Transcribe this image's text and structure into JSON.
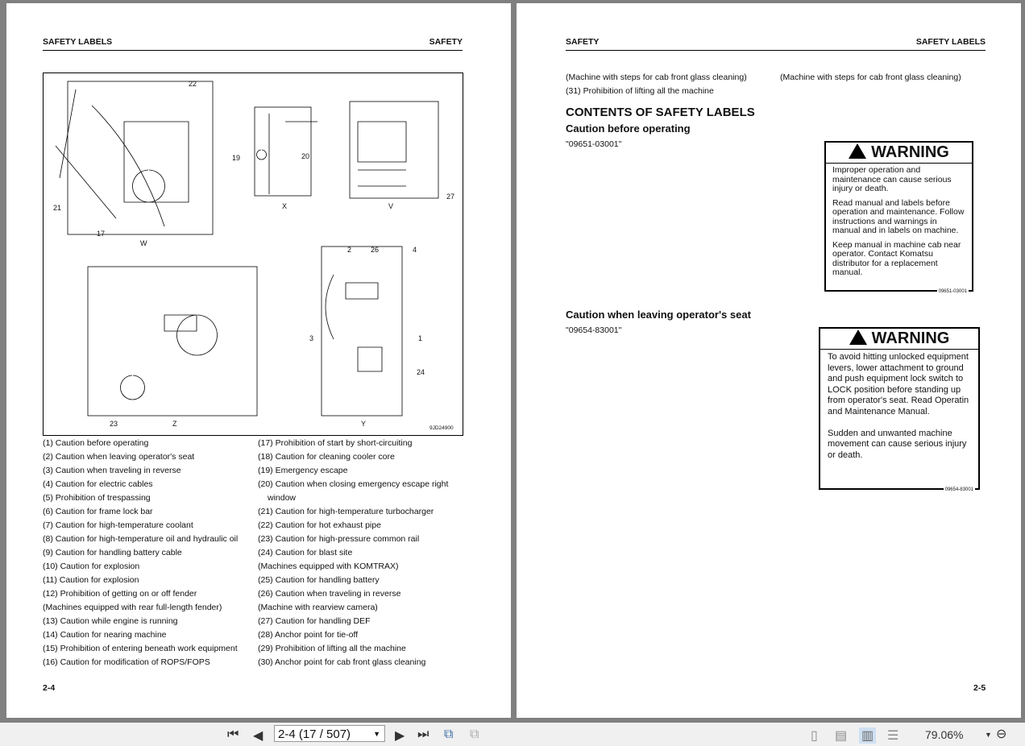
{
  "left_page": {
    "header_left": "SAFETY LABELS",
    "header_right": "SAFETY",
    "figure": {
      "code": "9JD24900",
      "views": [
        "W",
        "X",
        "V",
        "Z",
        "Y"
      ],
      "callouts": [
        "22",
        "21",
        "17",
        "19",
        "20",
        "27",
        "2",
        "26",
        "4",
        "3",
        "1",
        "24",
        "23"
      ]
    },
    "col1": [
      "(1) Caution before operating",
      "(2) Caution when leaving operator's seat",
      "(3) Caution when traveling in reverse",
      "(4) Caution for electric cables",
      "(5) Prohibition of trespassing",
      "(6) Caution for frame lock bar",
      "(7) Caution for high-temperature coolant",
      "(8) Caution for high-temperature oil and hydraulic oil",
      "(9) Caution for handling battery cable",
      "(10) Caution for explosion",
      "(11) Caution for explosion",
      "(12) Prohibition of getting on or off fender",
      "(Machines equipped with rear full-length fender)",
      "(13) Caution while engine is running",
      "(14) Caution for nearing machine",
      "(15) Prohibition of entering beneath work equipment",
      "(16) Caution for modification of ROPS/FOPS"
    ],
    "col2": [
      "(17) Prohibition of start by short-circuiting",
      "(18) Caution for cleaning cooler core",
      "(19) Emergency escape",
      "(20) Caution when closing emergency escape right",
      "window",
      "(21) Caution for high-temperature turbocharger",
      "(22) Caution for hot exhaust pipe",
      "(23) Caution for high-pressure common rail",
      "(24) Caution for blast site",
      "(Machines equipped with KOMTRAX)",
      "(25) Caution for handling battery",
      "(26) Caution when traveling in reverse",
      "(Machine with rearview camera)",
      "(27) Caution for handling DEF",
      "(28) Anchor point for tie-off",
      "(29) Prohibition of lifting all the machine",
      "(30) Anchor point for cab front glass cleaning"
    ],
    "page_number": "2-4"
  },
  "right_page": {
    "header_left": "SAFETY",
    "header_right": "SAFETY LABELS",
    "top_left": [
      "(Machine with steps for cab front glass cleaning)",
      "(31) Prohibition of lifting all the machine"
    ],
    "top_right": "(Machine with steps for cab front glass cleaning)",
    "title": "CONTENTS OF SAFETY LABELS",
    "section1": {
      "heading": "Caution before operating",
      "code": "\"09651-03001\"",
      "warning_title": "WARNING",
      "paragraphs": [
        "Improper operation and maintenance can cause serious injury or death.",
        "Read manual and labels before operation and maintenance. Follow instructions and warnings in manual and in labels on machine.",
        "Keep manual in machine cab near operator. Contact Komatsu distributor for a replacement manual."
      ],
      "label_code": "09651-03001"
    },
    "section2": {
      "heading": "Caution when leaving operator's seat",
      "code": "\"09654-83001\"",
      "warning_title": "WARNING",
      "paragraphs": [
        "To avoid hitting unlocked equipment levers, lower attachment to ground and push equipment lock switch to LOCK position before standing up from operator's seat. Read Operatin and Maintenance Manual.",
        "Sudden and unwanted machine movement can cause serious injury or death."
      ],
      "label_code": "09654-83001"
    },
    "page_number": "2-5"
  },
  "toolbar": {
    "page_field": "2-4 (17 / 507)",
    "zoom": "79.06%"
  }
}
